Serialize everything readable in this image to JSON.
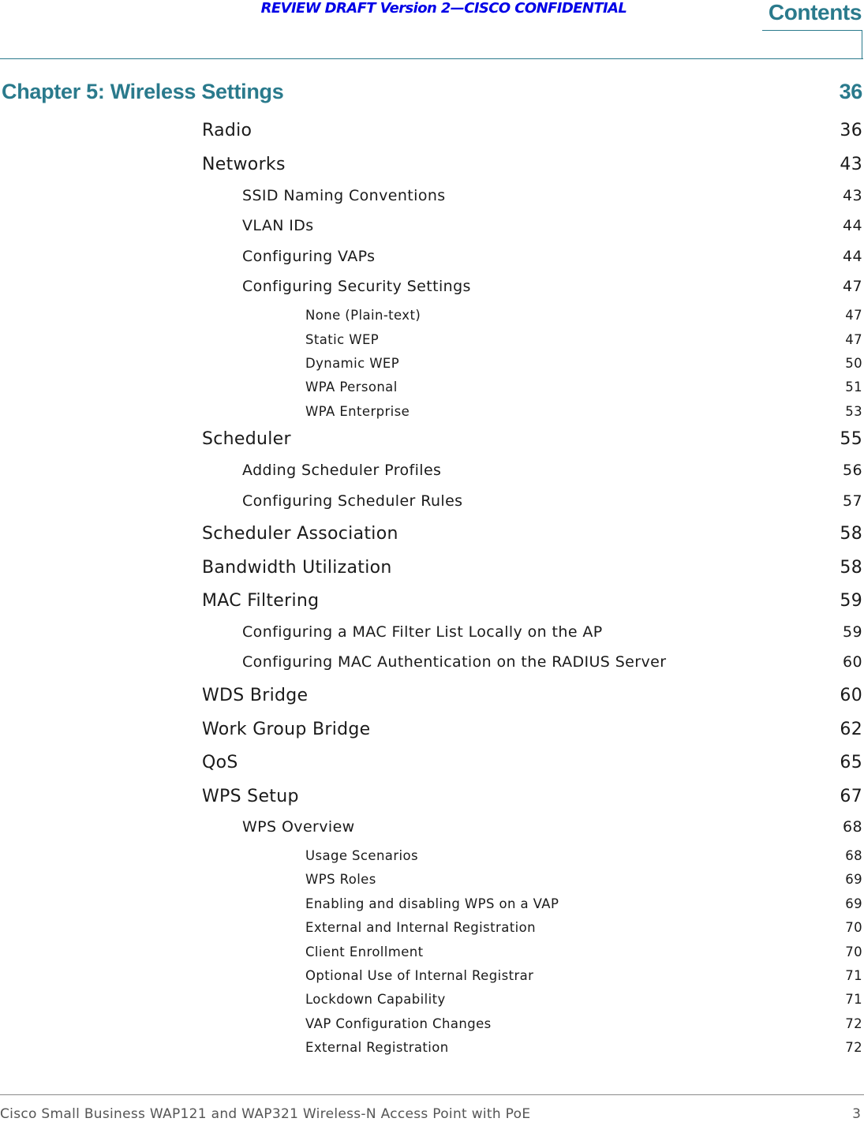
{
  "header": {
    "draft_notice": "REVIEW DRAFT  Version 2—CISCO CONFIDENTIAL",
    "section_title": "Contents",
    "accent_color": "#2a7a8c"
  },
  "chapter": {
    "title": "Chapter 5: Wireless Settings",
    "page": "36"
  },
  "entries": [
    {
      "level": 1,
      "title": "Radio",
      "page": "36"
    },
    {
      "level": 1,
      "title": "Networks",
      "page": "43"
    },
    {
      "level": 2,
      "title": "SSID Naming Conventions",
      "page": "43"
    },
    {
      "level": 2,
      "title": "VLAN IDs",
      "page": "44"
    },
    {
      "level": 2,
      "title": "Configuring VAPs",
      "page": "44"
    },
    {
      "level": 2,
      "title": "Configuring Security Settings",
      "page": "47"
    },
    {
      "level": 3,
      "title": "None (Plain-text)",
      "page": "47"
    },
    {
      "level": 3,
      "title": "Static WEP",
      "page": "47"
    },
    {
      "level": 3,
      "title": "Dynamic WEP",
      "page": "50"
    },
    {
      "level": 3,
      "title": "WPA Personal",
      "page": "51"
    },
    {
      "level": 3,
      "title": "WPA Enterprise",
      "page": "53"
    },
    {
      "level": 1,
      "title": "Scheduler",
      "page": "55"
    },
    {
      "level": 2,
      "title": "Adding Scheduler Profiles",
      "page": "56"
    },
    {
      "level": 2,
      "title": "Configuring Scheduler Rules",
      "page": "57"
    },
    {
      "level": 1,
      "title": "Scheduler Association",
      "page": "58"
    },
    {
      "level": 1,
      "title": "Bandwidth Utilization",
      "page": "58"
    },
    {
      "level": 1,
      "title": "MAC Filtering",
      "page": "59"
    },
    {
      "level": 2,
      "title": "Configuring a MAC Filter List Locally on the AP",
      "page": "59"
    },
    {
      "level": 2,
      "title": "Configuring MAC Authentication on the RADIUS Server",
      "page": "60"
    },
    {
      "level": 1,
      "title": "WDS Bridge",
      "page": "60"
    },
    {
      "level": 1,
      "title": "Work Group Bridge",
      "page": "62"
    },
    {
      "level": 1,
      "title": "QoS",
      "page": "65"
    },
    {
      "level": 1,
      "title": "WPS Setup",
      "page": "67"
    },
    {
      "level": 2,
      "title": "WPS Overview",
      "page": "68"
    },
    {
      "level": 3,
      "title": "Usage Scenarios",
      "page": "68"
    },
    {
      "level": 3,
      "title": "WPS Roles",
      "page": "69"
    },
    {
      "level": 3,
      "title": "Enabling and disabling WPS on a VAP",
      "page": "69"
    },
    {
      "level": 3,
      "title": "External and Internal Registration",
      "page": "70"
    },
    {
      "level": 3,
      "title": "Client Enrollment",
      "page": "70"
    },
    {
      "level": 3,
      "title": "Optional Use of Internal Registrar",
      "page": "71"
    },
    {
      "level": 3,
      "title": "Lockdown Capability",
      "page": "71"
    },
    {
      "level": 3,
      "title": "VAP Configuration Changes",
      "page": "72"
    },
    {
      "level": 3,
      "title": "External Registration",
      "page": "72"
    }
  ],
  "footer": {
    "text": "Cisco Small Business WAP121 and WAP321 Wireless-N Access Point with PoE",
    "page": "3"
  }
}
